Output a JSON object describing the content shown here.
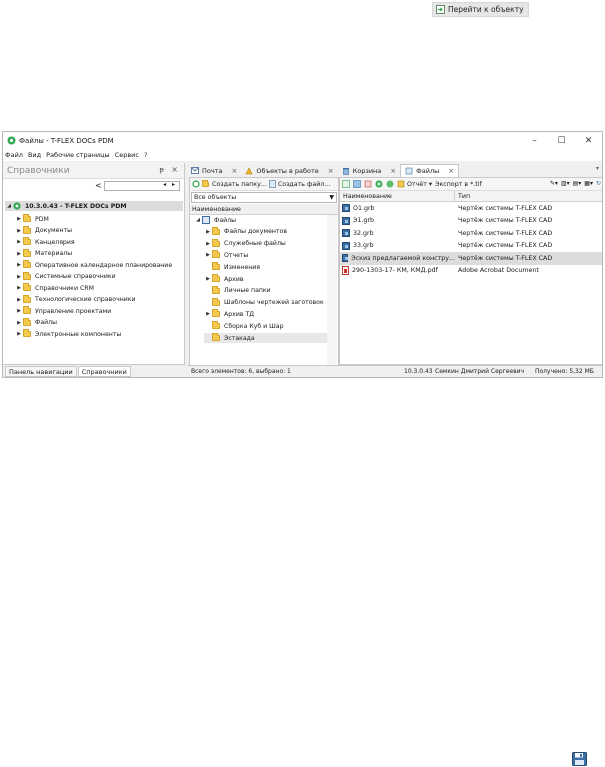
{
  "top_button": {
    "label": "Перейти к объекту",
    "icon": "go-to-object-icon"
  },
  "window": {
    "title": "Файлы - T-FLEX DOCs PDM",
    "controls": {
      "minimize": "–",
      "maximize": "☐",
      "close": "✕"
    }
  },
  "menu": [
    "Файл",
    "Вид",
    "Рабочие страницы",
    "Сервис",
    "?"
  ],
  "left_panel": {
    "title": "Справочники",
    "pin": "ᵽ",
    "close": "×",
    "root": "10.3.0.43 - T-FLEX DOCs PDM",
    "items": [
      "PDM",
      "Документы",
      "Канцелярия",
      "Материалы",
      "Оперативное календарное планирование",
      "Системные справочники",
      "Справочники CRM",
      "Технологические справочники",
      "Управление проектами",
      "Файлы",
      "Электронные компоненты"
    ],
    "tabs": [
      "Панель навигации",
      "Справочники"
    ]
  },
  "doc_tabs": [
    {
      "label": "Почта",
      "icon": "mail-icon"
    },
    {
      "label": "Объекты в работе",
      "icon": "work-objects-icon"
    },
    {
      "label": "Корзина",
      "icon": "trash-icon"
    },
    {
      "label": "Файлы",
      "icon": "files-icon"
    }
  ],
  "mid_panel": {
    "toolbar": {
      "create_folder": "Создать папку...",
      "create_file": "Создать файл..."
    },
    "filter": "Все объекты",
    "column": "Наименование",
    "tree": [
      {
        "label": "Файлы",
        "level": 0,
        "expander": "◢"
      },
      {
        "label": "Файлы документов",
        "level": 1,
        "expander": "▶"
      },
      {
        "label": "Служебные файлы",
        "level": 1,
        "expander": "▶"
      },
      {
        "label": "Отчеты",
        "level": 1,
        "expander": "▶"
      },
      {
        "label": "Изменения",
        "level": 1,
        "expander": ""
      },
      {
        "label": "Архив",
        "level": 1,
        "expander": "▶"
      },
      {
        "label": "Личные папки",
        "level": 1,
        "expander": ""
      },
      {
        "label": "Шаблоны чертежей заготовок",
        "level": 1,
        "expander": ""
      },
      {
        "label": "Архив ТД",
        "level": 1,
        "expander": "▶"
      },
      {
        "label": "Сборка Куб и Шар",
        "level": 1,
        "expander": ""
      },
      {
        "label": "Эстакада",
        "level": 1,
        "expander": ""
      }
    ]
  },
  "right_panel": {
    "toolbar": {
      "report": "Отчёт",
      "export": "Экспорт в *.tif"
    },
    "columns": [
      "Наименование",
      "Тип"
    ],
    "files": [
      {
        "name": "О1.grb",
        "type": "Чертёж системы T-FLEX CAD",
        "icon": "grb-file-icon"
      },
      {
        "name": "Э1.grb",
        "type": "Чертёж системы T-FLEX CAD",
        "icon": "grb-file-icon"
      },
      {
        "name": "32.grb",
        "type": "Чертёж системы T-FLEX CAD",
        "icon": "grb-file-icon"
      },
      {
        "name": "33.grb",
        "type": "Чертёж системы T-FLEX CAD",
        "icon": "grb-file-icon"
      },
      {
        "name": "Эскиз предлагаемой констру...",
        "type": "Чертёж системы T-FLEX CAD",
        "icon": "grb-file-icon"
      },
      {
        "name": "290-1303-17- КМ, КМД.pdf",
        "type": "Adobe Acrobat Document",
        "icon": "pdf-file-icon"
      }
    ],
    "selected_index": 4
  },
  "status": {
    "count": "Всего элементов: 6, выбрано: 1",
    "version": "10.3.0.43",
    "user": "Семкин Дмитрий Сергеевич",
    "received": "Получено: 5,32 МБ"
  },
  "colors": {
    "accent_green": "#2fa84f",
    "folder": "#f3c94e",
    "selection": "#dcdcdc"
  }
}
